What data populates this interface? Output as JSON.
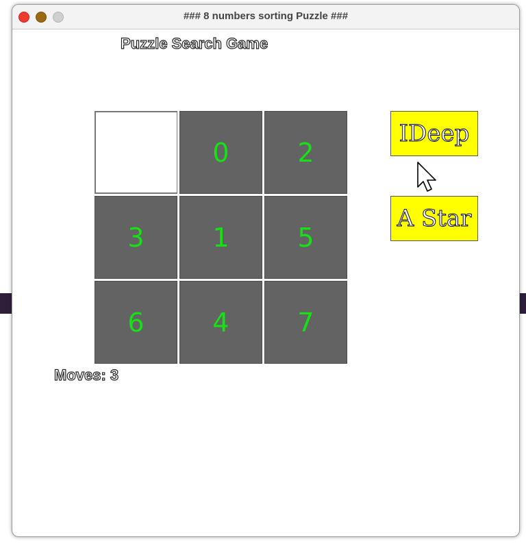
{
  "window": {
    "title": "### 8 numbers sorting Puzzle ###"
  },
  "game": {
    "title": "Puzzle Search Game",
    "moves_text": "Moves: 3"
  },
  "board": {
    "tiles": [
      "",
      "0",
      "2",
      "3",
      "1",
      "5",
      "6",
      "4",
      "7"
    ],
    "tile_color": "#636363",
    "number_color": "#15e115",
    "empty_color": "#ffffff"
  },
  "buttons": {
    "ideep_label": "IDeep",
    "astar_label": "A Star",
    "color": "#ffff00"
  },
  "traffic_lights": {
    "close_color": "#ee3b30",
    "minimize_color": "#9a6a12",
    "maximize_color": "#cfcfcf"
  }
}
